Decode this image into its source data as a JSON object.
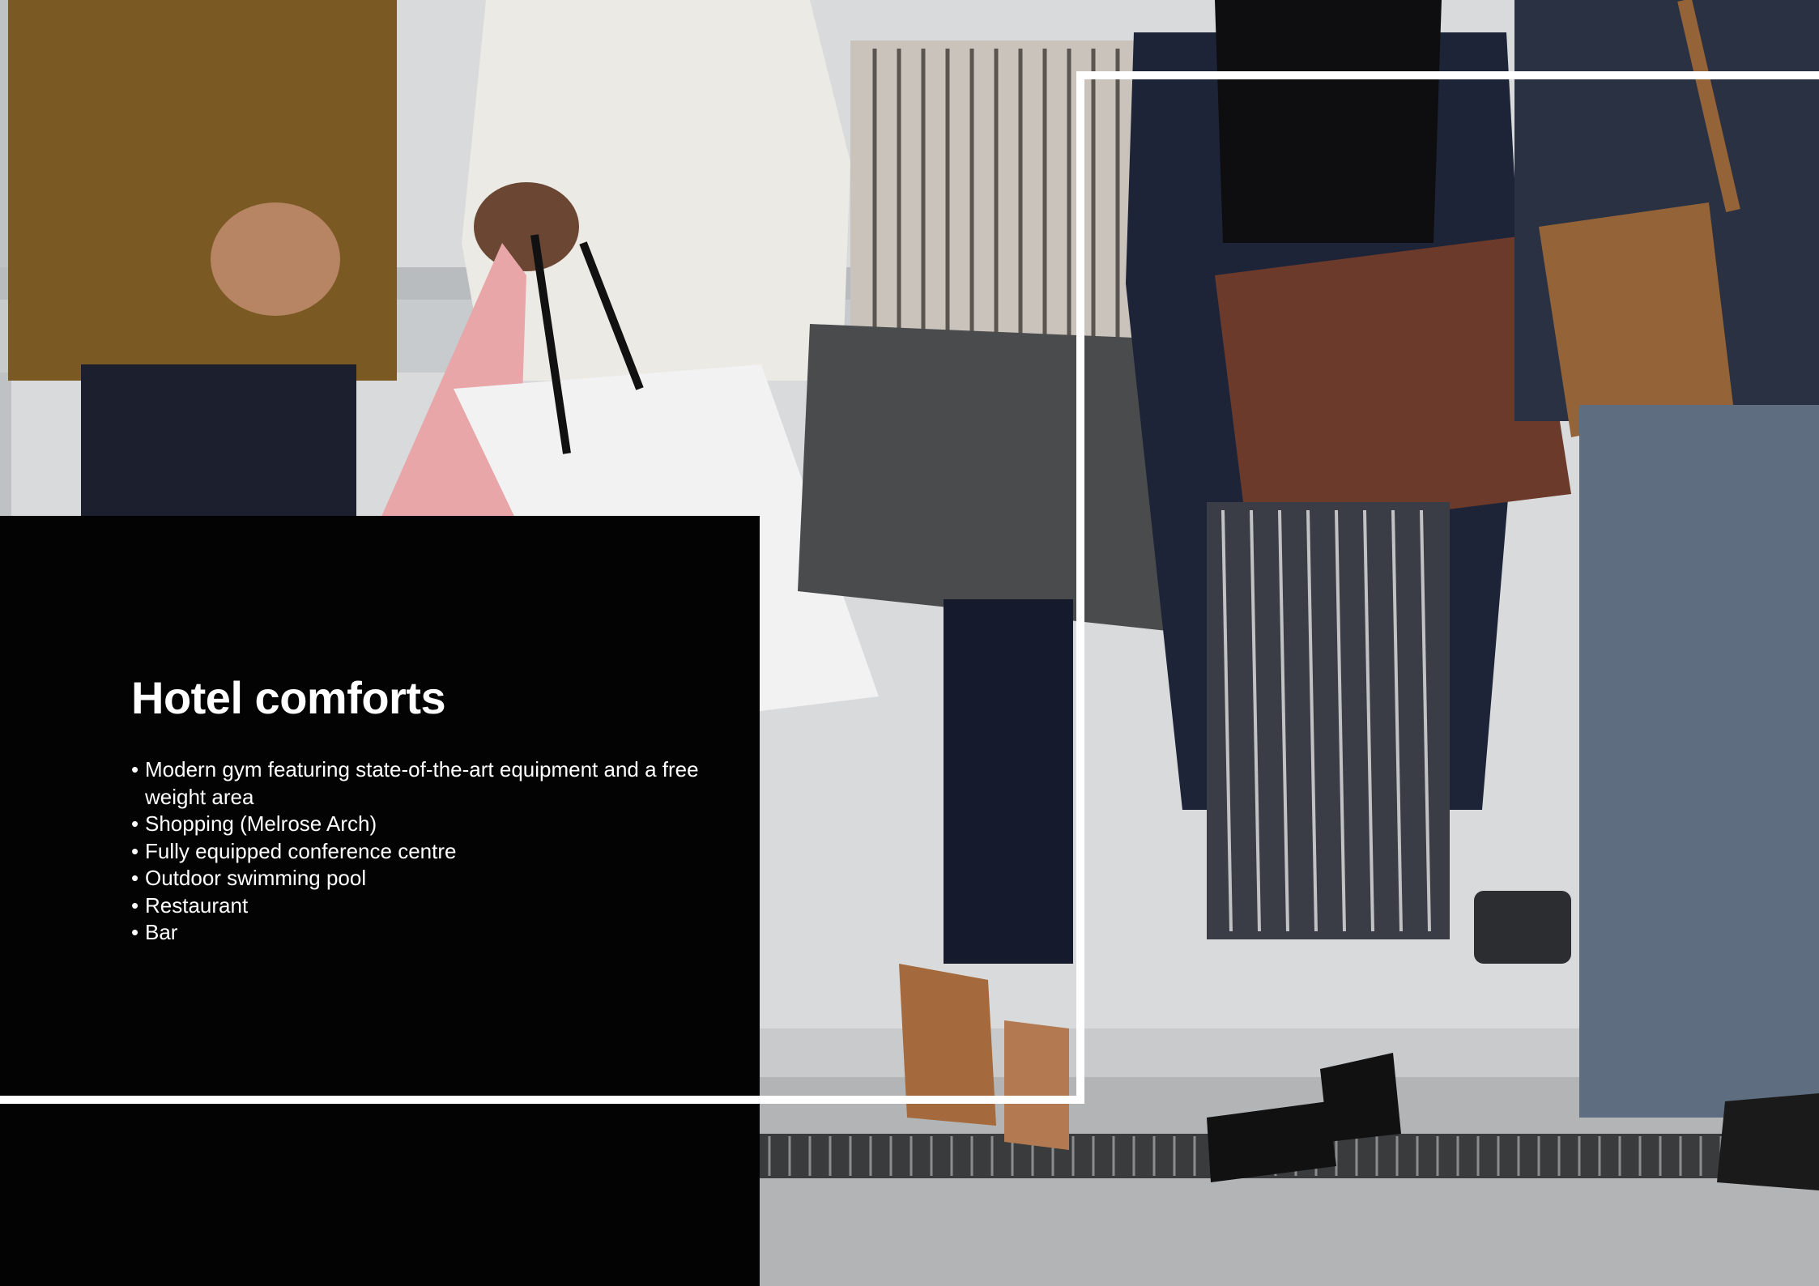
{
  "section": {
    "title": "Hotel comforts",
    "amenities": [
      "Modern gym featuring state-of-the-art equipment and a free weight area",
      "Shopping (Melrose Arch)",
      "Fully equipped conference centre",
      "Outdoor swimming pool",
      "Restaurant",
      "Bar"
    ]
  },
  "colors": {
    "panel": "#030303",
    "frame": "#ffffff",
    "text": "#ffffff"
  },
  "photo": {
    "subject": "people-holding-shopping-bags"
  }
}
